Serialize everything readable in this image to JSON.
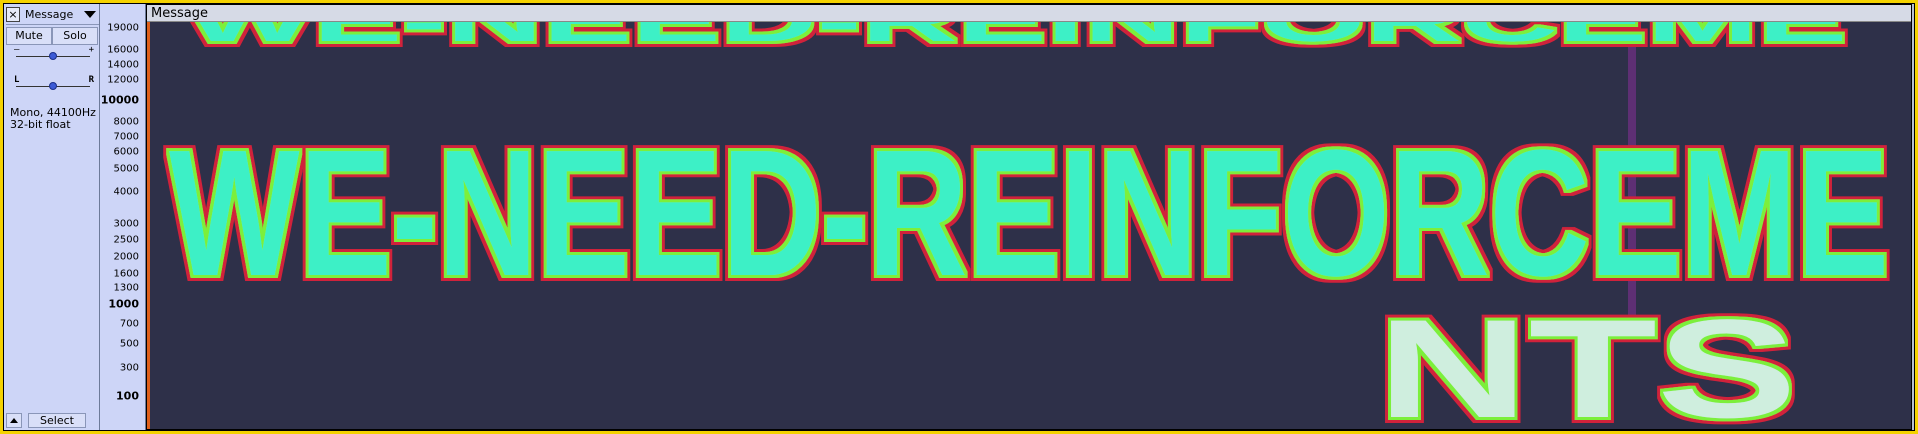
{
  "track": {
    "name": "Message",
    "close_glyph": "×",
    "mute_label": "Mute",
    "solo_label": "Solo",
    "gain_minus": "–",
    "gain_plus": "+",
    "pan_left": "L",
    "pan_right": "R",
    "format_line1": "Mono, 44100Hz",
    "format_line2": "32-bit float",
    "select_label": "Select"
  },
  "ruler": {
    "ticks": [
      "19000",
      "16000",
      "14000",
      "12000",
      "10000",
      "8000",
      "7000",
      "6000",
      "5000",
      "4000",
      "3000",
      "2500",
      "2000",
      "1600",
      "1300",
      "1000",
      "700",
      "500",
      "300",
      "100"
    ],
    "bold_ticks": [
      "10000",
      "1000",
      "100"
    ]
  },
  "clip": {
    "title": "Message",
    "text_top": "WE-NEED-REINFORCEME",
    "text_main": "WE-NEED-REINFORCEME",
    "text_bottom": "NTS"
  },
  "colors": {
    "frame_yellow": "#f4d200",
    "panel_bg": "#cdd5f7",
    "spectrogram_bg": "#2e3049",
    "glow_core": "#3ef0c6",
    "glow_mid": "#7bef3a",
    "glow_edge": "#d0223a"
  }
}
